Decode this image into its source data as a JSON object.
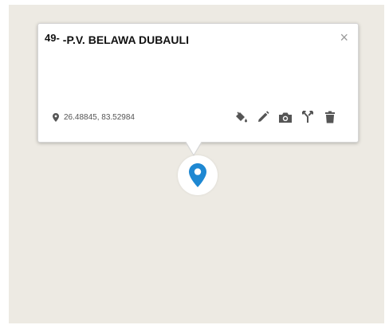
{
  "popup": {
    "number": "49-",
    "title": "-P.V. BELAWA DUBAULI",
    "close_glyph": "×",
    "coordinates": "26.48845, 83.52984"
  },
  "icons": {
    "location": "map-pin-icon",
    "style": "paint-bucket-icon",
    "edit": "pencil-icon",
    "photo": "camera-icon",
    "route": "fork-icon",
    "delete": "trash-icon",
    "marker": "location-marker-icon"
  },
  "colors": {
    "map_background": "#edeae3",
    "marker": "#1e88d2",
    "icon": "#555555"
  }
}
